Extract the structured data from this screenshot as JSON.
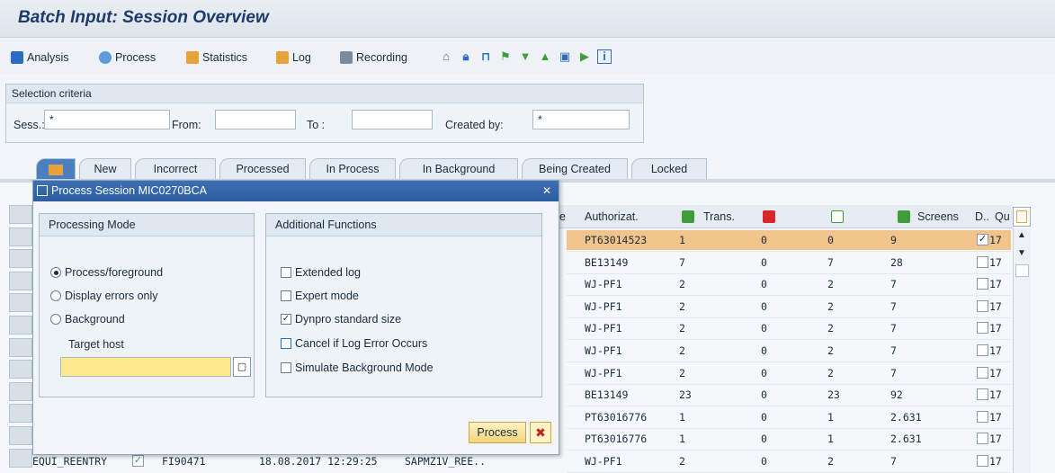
{
  "app": {
    "title": "Batch Input: Session Overview"
  },
  "toolbar": {
    "analysis": "Analysis",
    "process": "Process",
    "statistics": "Statistics",
    "log": "Log",
    "recording": "Recording"
  },
  "selection": {
    "header": "Selection criteria",
    "sess_label": "Sess.:",
    "sess_value": "*",
    "from_label": "From:",
    "from_value": "",
    "to_label": "To :",
    "to_value": "",
    "created_by_label": "Created by:",
    "created_by_value": "*"
  },
  "tabs": [
    "New",
    "Incorrect",
    "Processed",
    "In Process",
    "In Background",
    "Being Created",
    "Locked"
  ],
  "grid": {
    "headers": {
      "authorization": "Authorizat.",
      "trans": "Trans.",
      "screens": "Screens",
      "d": "D..",
      "q": "Qu"
    },
    "rows": [
      {
        "auth": "PT63014523",
        "trans": "1",
        "err": "0",
        "ok": "0",
        "screens": "9",
        "checked": true,
        "q": "17"
      },
      {
        "auth": "BE13149",
        "trans": "7",
        "err": "0",
        "ok": "7",
        "screens": "28",
        "checked": false,
        "q": "17"
      },
      {
        "auth": "WJ-PF1",
        "trans": "2",
        "err": "0",
        "ok": "2",
        "screens": "7",
        "checked": false,
        "q": "17"
      },
      {
        "auth": "WJ-PF1",
        "trans": "2",
        "err": "0",
        "ok": "2",
        "screens": "7",
        "checked": false,
        "q": "17"
      },
      {
        "auth": "WJ-PF1",
        "trans": "2",
        "err": "0",
        "ok": "2",
        "screens": "7",
        "checked": false,
        "q": "17"
      },
      {
        "auth": "WJ-PF1",
        "trans": "2",
        "err": "0",
        "ok": "2",
        "screens": "7",
        "checked": false,
        "q": "17"
      },
      {
        "auth": "WJ-PF1",
        "trans": "2",
        "err": "0",
        "ok": "2",
        "screens": "7",
        "checked": false,
        "q": "17"
      },
      {
        "auth": "BE13149",
        "trans": "23",
        "err": "0",
        "ok": "23",
        "screens": "92",
        "checked": false,
        "q": "17"
      },
      {
        "auth": "PT63016776",
        "trans": "1",
        "err": "0",
        "ok": "1",
        "screens": "2.631",
        "checked": false,
        "q": "17"
      },
      {
        "auth": "PT63016776",
        "trans": "1",
        "err": "0",
        "ok": "1",
        "screens": "2.631",
        "checked": false,
        "q": "17"
      },
      {
        "auth": "WJ-PF1",
        "trans": "2",
        "err": "0",
        "ok": "2",
        "screens": "7",
        "checked": false,
        "q": "17"
      }
    ],
    "last_row_left": {
      "session": "EQUI_REENTRY",
      "user": "FI90471",
      "datetime": "18.08.2017 12:29:25",
      "program": "SAPMZ1V_REE.."
    },
    "partial_header": "e"
  },
  "dialog": {
    "title": "Process Session MIC0270BCA",
    "processing_mode": {
      "header": "Processing Mode",
      "options": [
        "Process/foreground",
        "Display errors only",
        "Background"
      ],
      "selected": 0,
      "target_host_label": "Target host",
      "target_host_value": ""
    },
    "additional_functions": {
      "header": "Additional Functions",
      "options": [
        {
          "label": "Extended log",
          "checked": false
        },
        {
          "label": "Expert mode",
          "checked": false
        },
        {
          "label": "Dynpro standard size",
          "checked": true
        },
        {
          "label": "Cancel if Log Error Occurs",
          "checked": false
        },
        {
          "label": "Simulate Background Mode",
          "checked": false
        }
      ]
    },
    "process_button": "Process"
  }
}
